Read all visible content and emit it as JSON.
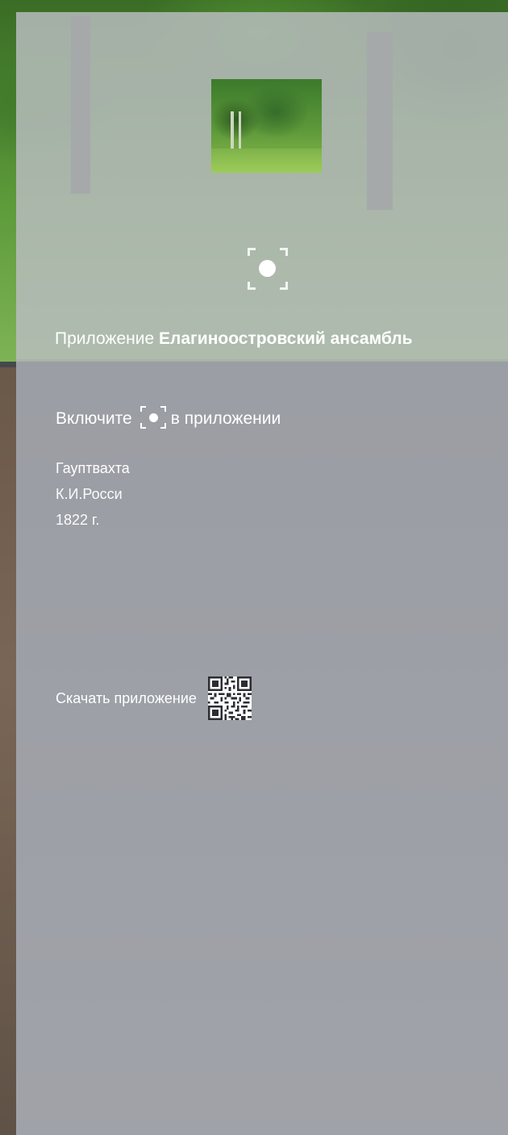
{
  "header": {
    "app_prefix": "Приложение",
    "app_name": "Елагиноостровский ансамбль",
    "icons": {
      "thumbnail": "garden-thumbnail",
      "scan": "scan-frame-icon"
    }
  },
  "enable": {
    "before": "Включите",
    "after": "в приложении",
    "icon": "scan-frame-icon"
  },
  "object": {
    "name": "Гауптвахта",
    "author": "К.И.Росси",
    "year": "1822 г."
  },
  "download": {
    "label": "Скачать приложение",
    "icon": "qr-code-icon"
  },
  "colors": {
    "panel_overlay": "#b4b6bc",
    "text": "#ffffff"
  }
}
